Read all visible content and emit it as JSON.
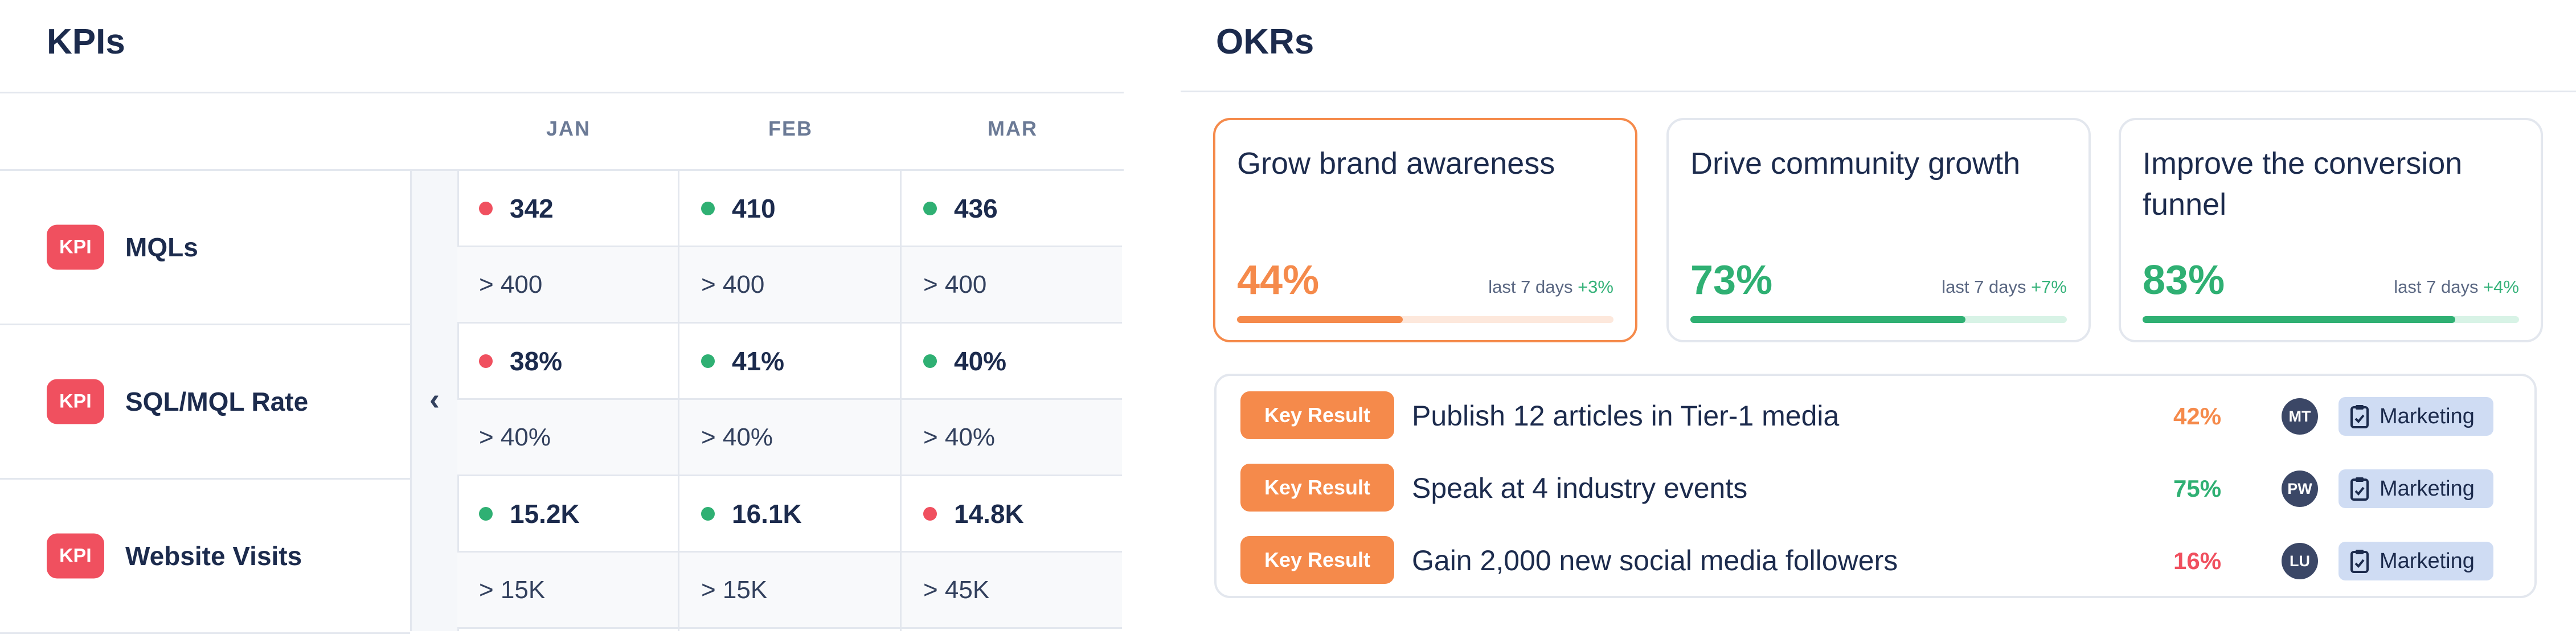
{
  "kpis": {
    "title": "KPIs",
    "collapse_icon": "chevron-left-icon",
    "months": [
      "JAN",
      "FEB",
      "MAR"
    ],
    "badge_label": "KPI",
    "rows": [
      {
        "name": "MQLs",
        "cells": [
          {
            "value": "342",
            "status": "red",
            "target": ">  400"
          },
          {
            "value": "410",
            "status": "green",
            "target": ">  400"
          },
          {
            "value": "436",
            "status": "green",
            "target": ">  400"
          }
        ]
      },
      {
        "name": "SQL/MQL Rate",
        "cells": [
          {
            "value": "38%",
            "status": "red",
            "target": ">  40%"
          },
          {
            "value": "41%",
            "status": "green",
            "target": ">  40%"
          },
          {
            "value": "40%",
            "status": "green",
            "target": ">  40%"
          }
        ]
      },
      {
        "name": "Website Visits",
        "cells": [
          {
            "value": "15.2K",
            "status": "green",
            "target": ">  15K"
          },
          {
            "value": "16.1K",
            "status": "green",
            "target": ">  15K"
          },
          {
            "value": "14.8K",
            "status": "red",
            "target": ">  45K"
          }
        ]
      }
    ],
    "status_colors": {
      "red": "#f0505f",
      "green": "#2fb073"
    }
  },
  "okrs": {
    "title": "OKRs",
    "cards": [
      {
        "title": "Grow brand awareness",
        "percent_label": "44%",
        "progress": 0.44,
        "trend_label": "last 7 days",
        "trend_delta": "+3%",
        "active": true,
        "accent": "#f58a4b",
        "track": "#fde8dc"
      },
      {
        "title": "Drive community growth",
        "percent_label": "73%",
        "progress": 0.73,
        "trend_label": "last 7 days",
        "trend_delta": "+7%",
        "active": false,
        "accent": "#2fb073",
        "track": "#d8f3e6"
      },
      {
        "title": "Improve the conversion funnel",
        "percent_label": "83%",
        "progress": 0.83,
        "trend_label": "last 7 days",
        "trend_delta": "+4%",
        "active": false,
        "accent": "#2fb073",
        "track": "#d8f3e6"
      }
    ],
    "key_results": [
      {
        "badge": "Key Result",
        "text": "Publish 12 articles in Tier-1 media",
        "percent": "42%",
        "percent_color": "#f58a4b",
        "avatar": "MT",
        "tag": "Marketing",
        "tag_icon": "clipboard-icon"
      },
      {
        "badge": "Key Result",
        "text": "Speak at 4 industry events",
        "percent": "75%",
        "percent_color": "#2fb073",
        "avatar": "PW",
        "tag": "Marketing",
        "tag_icon": "clipboard-icon"
      },
      {
        "badge": "Key Result",
        "text": "Gain 2,000 new social media followers",
        "percent": "16%",
        "percent_color": "#f0505f",
        "avatar": "LU",
        "tag": "Marketing",
        "tag_icon": "clipboard-icon"
      }
    ]
  }
}
